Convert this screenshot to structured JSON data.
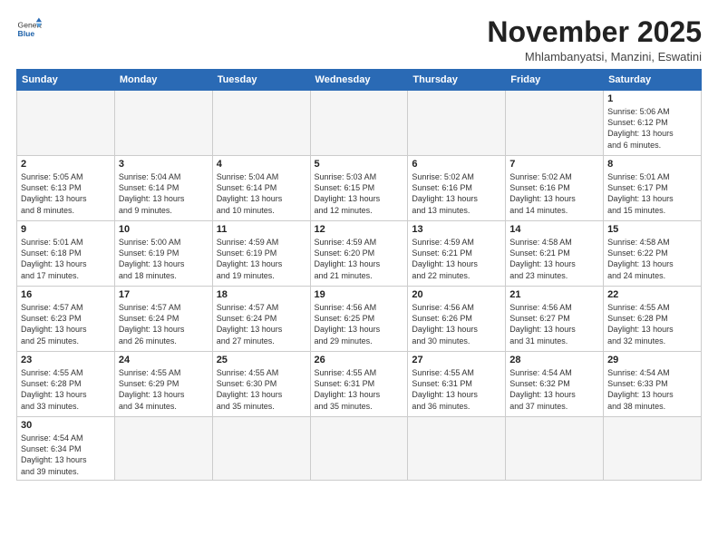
{
  "header": {
    "logo_general": "General",
    "logo_blue": "Blue",
    "month": "November 2025",
    "location": "Mhlambanyatsi, Manzini, Eswatini"
  },
  "weekdays": [
    "Sunday",
    "Monday",
    "Tuesday",
    "Wednesday",
    "Thursday",
    "Friday",
    "Saturday"
  ],
  "weeks": [
    [
      {
        "day": "",
        "info": ""
      },
      {
        "day": "",
        "info": ""
      },
      {
        "day": "",
        "info": ""
      },
      {
        "day": "",
        "info": ""
      },
      {
        "day": "",
        "info": ""
      },
      {
        "day": "",
        "info": ""
      },
      {
        "day": "1",
        "info": "Sunrise: 5:06 AM\nSunset: 6:12 PM\nDaylight: 13 hours\nand 6 minutes."
      }
    ],
    [
      {
        "day": "2",
        "info": "Sunrise: 5:05 AM\nSunset: 6:13 PM\nDaylight: 13 hours\nand 8 minutes."
      },
      {
        "day": "3",
        "info": "Sunrise: 5:04 AM\nSunset: 6:14 PM\nDaylight: 13 hours\nand 9 minutes."
      },
      {
        "day": "4",
        "info": "Sunrise: 5:04 AM\nSunset: 6:14 PM\nDaylight: 13 hours\nand 10 minutes."
      },
      {
        "day": "5",
        "info": "Sunrise: 5:03 AM\nSunset: 6:15 PM\nDaylight: 13 hours\nand 12 minutes."
      },
      {
        "day": "6",
        "info": "Sunrise: 5:02 AM\nSunset: 6:16 PM\nDaylight: 13 hours\nand 13 minutes."
      },
      {
        "day": "7",
        "info": "Sunrise: 5:02 AM\nSunset: 6:16 PM\nDaylight: 13 hours\nand 14 minutes."
      },
      {
        "day": "8",
        "info": "Sunrise: 5:01 AM\nSunset: 6:17 PM\nDaylight: 13 hours\nand 15 minutes."
      }
    ],
    [
      {
        "day": "9",
        "info": "Sunrise: 5:01 AM\nSunset: 6:18 PM\nDaylight: 13 hours\nand 17 minutes."
      },
      {
        "day": "10",
        "info": "Sunrise: 5:00 AM\nSunset: 6:19 PM\nDaylight: 13 hours\nand 18 minutes."
      },
      {
        "day": "11",
        "info": "Sunrise: 4:59 AM\nSunset: 6:19 PM\nDaylight: 13 hours\nand 19 minutes."
      },
      {
        "day": "12",
        "info": "Sunrise: 4:59 AM\nSunset: 6:20 PM\nDaylight: 13 hours\nand 21 minutes."
      },
      {
        "day": "13",
        "info": "Sunrise: 4:59 AM\nSunset: 6:21 PM\nDaylight: 13 hours\nand 22 minutes."
      },
      {
        "day": "14",
        "info": "Sunrise: 4:58 AM\nSunset: 6:21 PM\nDaylight: 13 hours\nand 23 minutes."
      },
      {
        "day": "15",
        "info": "Sunrise: 4:58 AM\nSunset: 6:22 PM\nDaylight: 13 hours\nand 24 minutes."
      }
    ],
    [
      {
        "day": "16",
        "info": "Sunrise: 4:57 AM\nSunset: 6:23 PM\nDaylight: 13 hours\nand 25 minutes."
      },
      {
        "day": "17",
        "info": "Sunrise: 4:57 AM\nSunset: 6:24 PM\nDaylight: 13 hours\nand 26 minutes."
      },
      {
        "day": "18",
        "info": "Sunrise: 4:57 AM\nSunset: 6:24 PM\nDaylight: 13 hours\nand 27 minutes."
      },
      {
        "day": "19",
        "info": "Sunrise: 4:56 AM\nSunset: 6:25 PM\nDaylight: 13 hours\nand 29 minutes."
      },
      {
        "day": "20",
        "info": "Sunrise: 4:56 AM\nSunset: 6:26 PM\nDaylight: 13 hours\nand 30 minutes."
      },
      {
        "day": "21",
        "info": "Sunrise: 4:56 AM\nSunset: 6:27 PM\nDaylight: 13 hours\nand 31 minutes."
      },
      {
        "day": "22",
        "info": "Sunrise: 4:55 AM\nSunset: 6:28 PM\nDaylight: 13 hours\nand 32 minutes."
      }
    ],
    [
      {
        "day": "23",
        "info": "Sunrise: 4:55 AM\nSunset: 6:28 PM\nDaylight: 13 hours\nand 33 minutes."
      },
      {
        "day": "24",
        "info": "Sunrise: 4:55 AM\nSunset: 6:29 PM\nDaylight: 13 hours\nand 34 minutes."
      },
      {
        "day": "25",
        "info": "Sunrise: 4:55 AM\nSunset: 6:30 PM\nDaylight: 13 hours\nand 35 minutes."
      },
      {
        "day": "26",
        "info": "Sunrise: 4:55 AM\nSunset: 6:31 PM\nDaylight: 13 hours\nand 35 minutes."
      },
      {
        "day": "27",
        "info": "Sunrise: 4:55 AM\nSunset: 6:31 PM\nDaylight: 13 hours\nand 36 minutes."
      },
      {
        "day": "28",
        "info": "Sunrise: 4:54 AM\nSunset: 6:32 PM\nDaylight: 13 hours\nand 37 minutes."
      },
      {
        "day": "29",
        "info": "Sunrise: 4:54 AM\nSunset: 6:33 PM\nDaylight: 13 hours\nand 38 minutes."
      }
    ],
    [
      {
        "day": "30",
        "info": "Sunrise: 4:54 AM\nSunset: 6:34 PM\nDaylight: 13 hours\nand 39 minutes."
      },
      {
        "day": "",
        "info": ""
      },
      {
        "day": "",
        "info": ""
      },
      {
        "day": "",
        "info": ""
      },
      {
        "day": "",
        "info": ""
      },
      {
        "day": "",
        "info": ""
      },
      {
        "day": "",
        "info": ""
      }
    ]
  ]
}
